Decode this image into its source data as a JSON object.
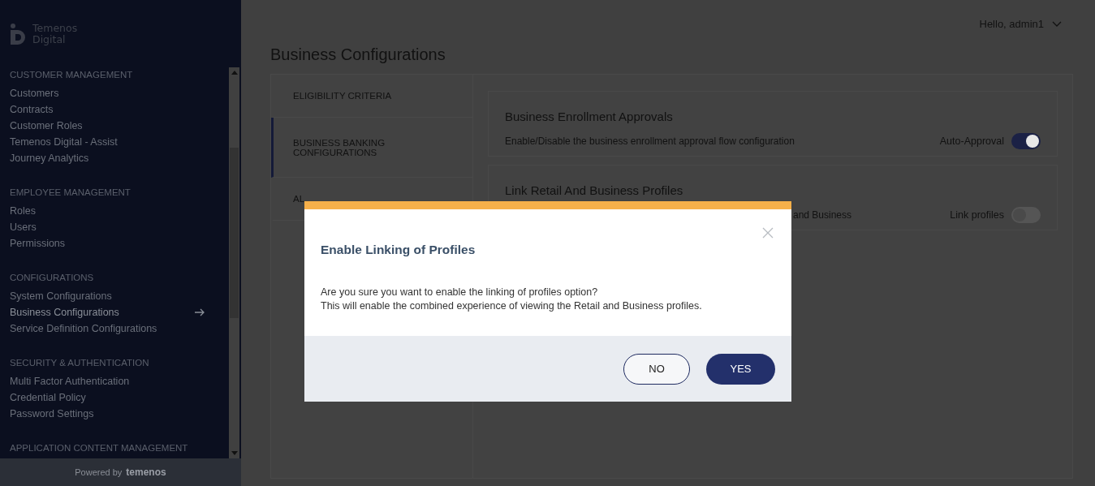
{
  "logo": {
    "line_1": "Temenos",
    "line_2": "Digital"
  },
  "sidebar": {
    "sections": [
      {
        "heading": "CUSTOMER MANAGEMENT",
        "items": [
          {
            "label": "Customers",
            "selected": false
          },
          {
            "label": "Contracts",
            "selected": false
          },
          {
            "label": "Customer Roles",
            "selected": false
          },
          {
            "label": "Temenos Digital - Assist",
            "selected": false
          },
          {
            "label": "Journey Analytics",
            "selected": false
          }
        ]
      },
      {
        "heading": "EMPLOYEE MANAGEMENT",
        "items": [
          {
            "label": "Roles",
            "selected": false
          },
          {
            "label": "Users",
            "selected": false
          },
          {
            "label": "Permissions",
            "selected": false
          }
        ]
      },
      {
        "heading": "CONFIGURATIONS",
        "items": [
          {
            "label": "System Configurations",
            "selected": false
          },
          {
            "label": "Business Configurations",
            "selected": true
          },
          {
            "label": "Service Definition Configurations",
            "selected": false
          }
        ]
      },
      {
        "heading": "SECURITY & AUTHENTICATION",
        "items": [
          {
            "label": "Multi Factor Authentication",
            "selected": false
          },
          {
            "label": "Credential Policy",
            "selected": false
          },
          {
            "label": "Password Settings",
            "selected": false
          }
        ]
      },
      {
        "heading": "APPLICATION CONTENT MANAGEMENT"
      }
    ],
    "footer": {
      "prefix": "Powered by",
      "brand": "temenos"
    }
  },
  "user_menu": {
    "label": "Hello, admin1"
  },
  "page_title": "Business Configurations",
  "tabs": [
    {
      "label": "ELIGIBILITY CRITERIA",
      "selected": false
    },
    {
      "label": "BUSINESS BANKING CONFIGURATIONS",
      "selected": true
    },
    {
      "label": "AL",
      "selected": false
    }
  ],
  "cards": [
    {
      "title": "Business Enrollment Approvals",
      "description": "Enable/Disable the business enrollment approval flow configuration",
      "toggle_label": "Auto-Approval",
      "on": true,
      "covered": false
    },
    {
      "title": "Link Retail And Business Profiles",
      "description": "and Business",
      "toggle_label": "Link profiles",
      "on": false,
      "covered": true
    }
  ],
  "dialog": {
    "title": "Enable Linking of Profiles",
    "message_lines": [
      "Are you sure you want to enable the linking of profiles option?",
      "This will enable the combined experience of viewing the Retail and Business profiles."
    ],
    "buttons": [
      {
        "label": "NO",
        "kind": "secondary"
      },
      {
        "label": "YES",
        "kind": "primary"
      }
    ]
  }
}
